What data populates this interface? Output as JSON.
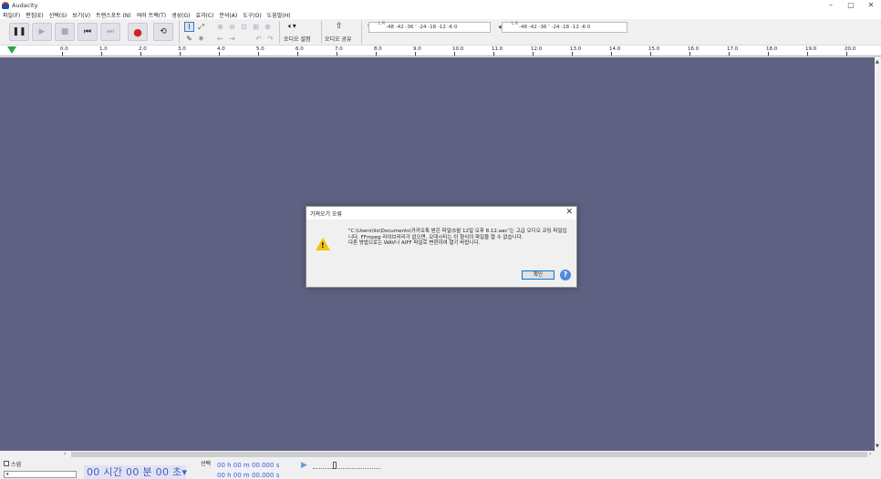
{
  "window": {
    "title": "Audacity",
    "minimize": "–",
    "restore": "▢",
    "close": "✕"
  },
  "menu": [
    "파일(F)",
    "편집(E)",
    "선택(S)",
    "보기(V)",
    "트랜스포트 (N)",
    "여러 트랙(T)",
    "생성(G)",
    "효과(C)",
    "분석(A)",
    "도구(O)",
    "도움말(H)"
  ],
  "toolbar": {
    "audio_setup": "오디오 설정",
    "audio_share": "오디오 공유",
    "record_meter_scale": "-48 -42 -36 ' -24 -18 -12 -6 0",
    "play_meter_scale": "-48 -42 -36 ' -24 -18 -12 -6 0",
    "meter_lr": "L R"
  },
  "ruler": {
    "labels": [
      "0.0",
      "1.0",
      "2.0",
      "3.0",
      "4.0",
      "5.0",
      "6.0",
      "7.0",
      "8.0",
      "9.0",
      "10.0",
      "11.0",
      "12.0",
      "13.0",
      "14.0",
      "15.0",
      "16.0",
      "17.0",
      "18.0",
      "19.0",
      "20.0"
    ]
  },
  "dialog": {
    "title": "가져오기 오류",
    "message": "\"C:\\Users\\lio\\Documents\\카카오톡 받은 파일\\5월 12일 오후 8.12.aac\"는 고급 오디오 코딩 파일입니다. FFmpeg 라이브러리가 없으면, 오대시티는 이 형식의 파일을 열 수 없습니다.\n다른 방법으로는 WAV나 AIFF 파일로 변환하여 열기 바랍니다.",
    "ok_label": "확인",
    "help_label": "?"
  },
  "bottom": {
    "snap_label": "스냅",
    "time_display": "00 시간 00 분 00 초",
    "selection_label": "선택",
    "selection_start": "00 h 00 m 00.000 s",
    "selection_end": "00 h 00 m 00.000 s"
  },
  "colors": {
    "workspace": "#5f6183",
    "accent": "#0078d7",
    "record": "#d42222"
  }
}
